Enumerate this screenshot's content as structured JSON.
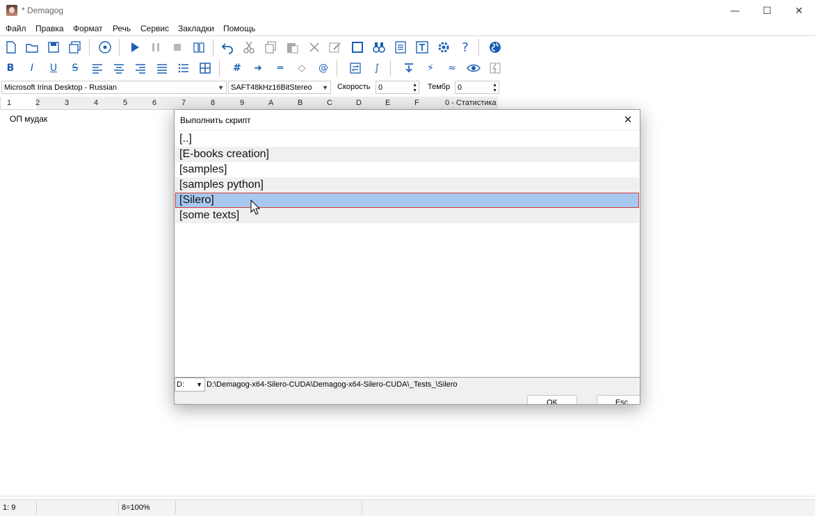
{
  "window": {
    "title": "* Demagog"
  },
  "menu": [
    "Файл",
    "Правка",
    "Формат",
    "Речь",
    "Сервис",
    "Закладки",
    "Помощь"
  ],
  "toolbar_icons": [
    "new-file-icon",
    "open-folder-icon",
    "save-icon",
    "save-all-icon",
    "cd-icon",
    "play-icon",
    "pause-icon",
    "stop-icon",
    "book-icon",
    "undo-icon",
    "cut-icon",
    "copy-icon",
    "paste-icon",
    "delete-icon",
    "edit-icon",
    "frame-icon",
    "binoculars-icon",
    "document-list-icon",
    "text-box-icon",
    "gear-icon",
    "help-icon",
    "globe-icon"
  ],
  "format_bar": {
    "bold": "B",
    "italic": "I",
    "underline": "U",
    "strike": "S",
    "hash": "#",
    "arrow": "➜",
    "equals": "═",
    "diamond": "◇",
    "at": "@",
    "integral": "∫",
    "lightning": "⚡",
    "tilde": "≈"
  },
  "voice": {
    "engine": "Microsoft Irina Desktop - Russian",
    "format": "SAFT48kHz16BitStereo",
    "speed_label": "Скорость",
    "speed_value": "0",
    "pitch_label": "Тембр",
    "pitch_value": "0"
  },
  "tabs": [
    "1",
    "2",
    "3",
    "4",
    "5",
    "6",
    "7",
    "8",
    "9",
    "A",
    "B",
    "C",
    "D",
    "E",
    "F",
    "0 - Статистика"
  ],
  "document": {
    "text": "ОП мудак"
  },
  "dialog": {
    "title": "Выполнить скрипт",
    "items": [
      "[..]",
      "[E-books creation]",
      "[samples]",
      "[samples python]",
      "[Silero]",
      "[some texts]"
    ],
    "selected_index": 4,
    "drive": "D:",
    "path": "D:\\Demagog-x64-Silero-CUDA\\Demagog-x64-Silero-CUDA\\_Tests_\\Silero",
    "ok_label": "OK",
    "esc_label": "Esc"
  },
  "status": {
    "position": "1: 9",
    "zoom": "8=100%"
  },
  "colors": {
    "accent_blue": "#1a5fb4",
    "selection": "#a8c8ef",
    "selection_border": "#d33b3b"
  }
}
